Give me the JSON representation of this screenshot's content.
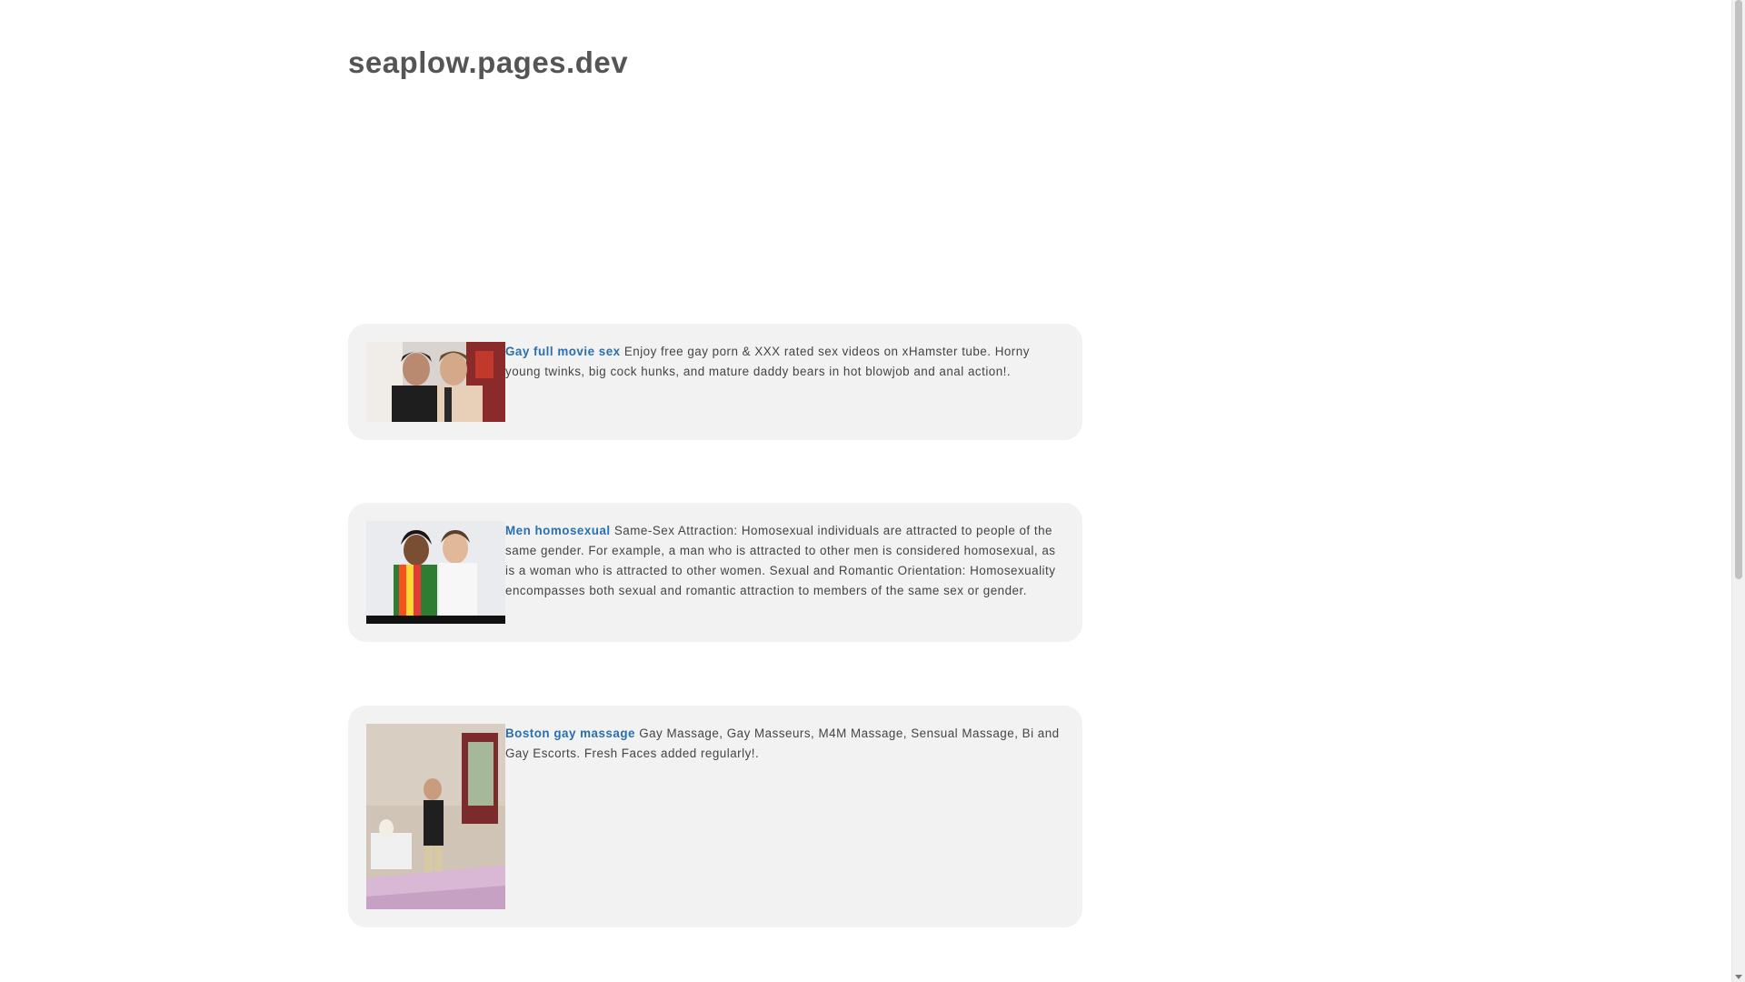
{
  "site": {
    "title": "seaplow.pages.dev"
  },
  "posts": [
    {
      "link_text": "Gay full movie sex",
      "description": "Enjoy free gay porn & XXX rated sex videos on xHamster tube. Horny young twinks, big cock hunks, and mature daddy bears in hot blowjob and anal action!."
    },
    {
      "link_text": "Men homosexual",
      "description": "Same-Sex Attraction: Homosexual individuals are attracted to people of the same gender. For example, a man who is attracted to other men is considered homosexual, as is a woman who is attracted to other women. Sexual and Romantic Orientation: Homosexuality encompasses both sexual and romantic attraction to members of the same sex or gender."
    },
    {
      "link_text": "Boston gay massage",
      "description": "Gay Massage, Gay Masseurs, M4M Massage, Sensual Massage, Bi and Gay Escorts. Fresh Faces added regularly!."
    }
  ],
  "colors": {
    "link": "#2a6fb0",
    "card_bg": "#f2f2f2",
    "title": "#555555",
    "body_text": "#444444"
  }
}
